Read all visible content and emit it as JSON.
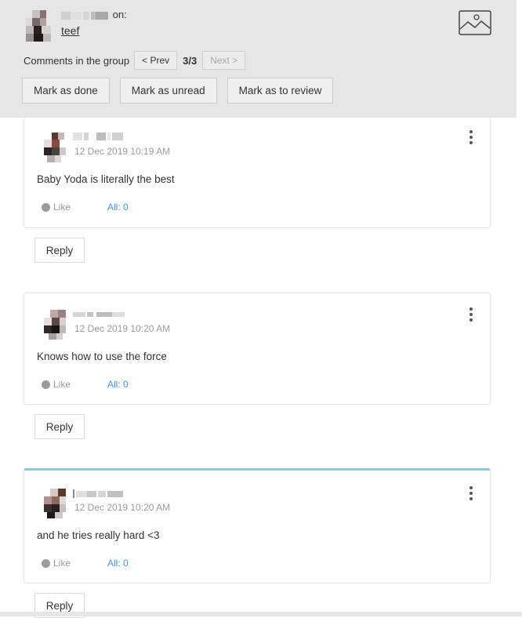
{
  "header": {
    "author_suffix": "on:",
    "target_label": "teef",
    "icon": "image-icon"
  },
  "group_nav": {
    "label": "Comments in the group",
    "prev_label": "< Prev",
    "counter": "3/3",
    "next_label": "Next >"
  },
  "actions": {
    "mark_done": "Mark as done",
    "mark_unread": "Mark as unread",
    "mark_review": "Mark as to review"
  },
  "comments": [
    {
      "timestamp": "12 Dec 2019 10:19 AM",
      "text": "Baby Yoda is literally the best",
      "like_label": "Like",
      "all_label": "All: 0",
      "reply_label": "Reply"
    },
    {
      "timestamp": "12 Dec 2019 10:20 AM",
      "text": "Knows how to use the force",
      "like_label": "Like",
      "all_label": "All: 0",
      "reply_label": "Reply"
    },
    {
      "timestamp": "12 Dec 2019 10:20 AM",
      "text": "and he tries really hard <3",
      "like_label": "Like",
      "all_label": "All: 0",
      "reply_label": "Reply",
      "highlighted": true
    }
  ],
  "colors": {
    "header_bg": "#e6e6e6",
    "link_blue": "#4a90e2",
    "highlight_border": "#8cc8ee",
    "muted_text": "#9b9b9b"
  }
}
